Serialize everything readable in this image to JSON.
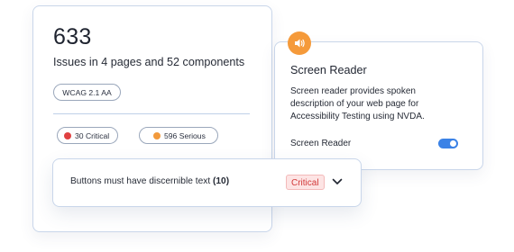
{
  "issues_card": {
    "count": "633",
    "summary": "Issues in 4 pages and 52 components",
    "standard_pill": "WCAG 2.1 AA",
    "severity_pills": [
      {
        "label": "30 Critical",
        "color": "#e04141"
      },
      {
        "label": "596 Serious",
        "color": "#f29a3c"
      }
    ]
  },
  "screen_reader_card": {
    "title": "Screen Reader",
    "description": "Screen reader provides spoken description of your web page for Accessibility Testing using NVDA.",
    "toggle_label": "Screen Reader",
    "toggle_on": true,
    "badge_icon": "speaker-icon",
    "accent_color": "#f59a3a",
    "toggle_color": "#3b82e6"
  },
  "rule_row": {
    "text": "Buttons must have discernible text",
    "count": "(10)",
    "severity": "Critical",
    "expand_icon": "chevron-down-icon"
  }
}
